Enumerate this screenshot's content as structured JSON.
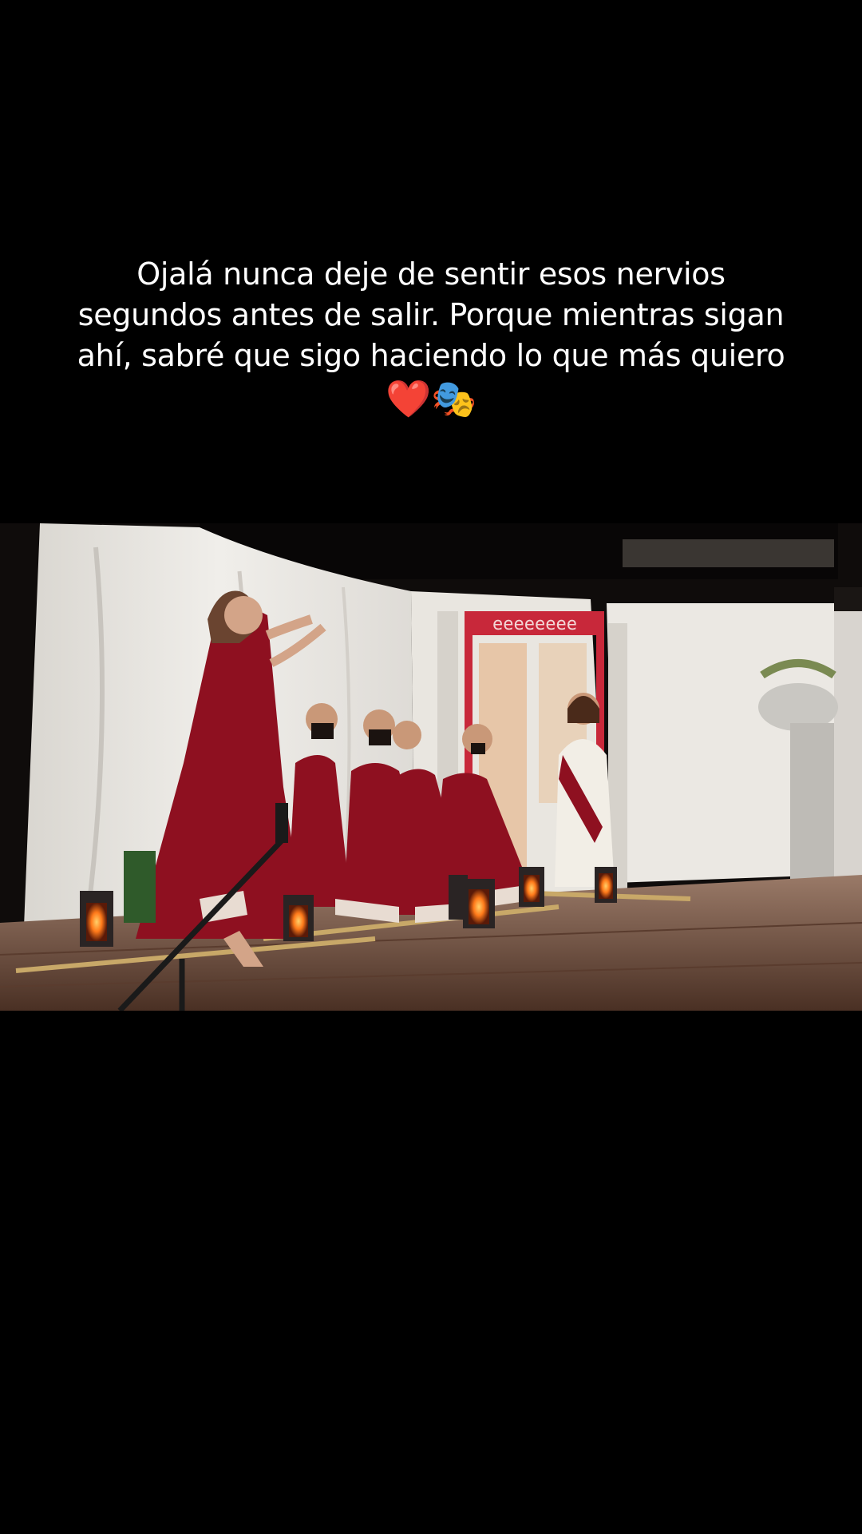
{
  "caption": {
    "line1": "Ojalá nunca deje de sentir esos nervios",
    "line2": "segundos antes de salir. Porque mientras sigan",
    "line3": "ahí, sabré que sigo haciendo lo que más quiero",
    "emojis": "❤️🎭"
  },
  "scene": {
    "description_icon": "theatre-stage-photo",
    "meander_pattern": "ееееееее",
    "colors": {
      "backdrop": "#e8e6e2",
      "costume_red": "#8e1020",
      "floor": "#6a4a3a",
      "lantern_glow": "#ff8a2a"
    }
  }
}
